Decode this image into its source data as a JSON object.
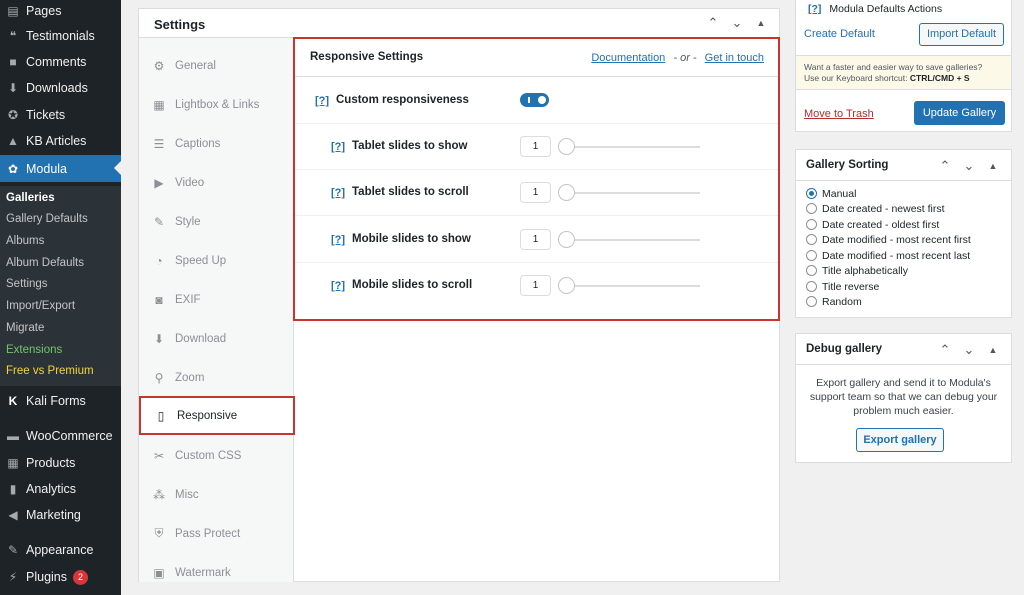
{
  "admin_menu": {
    "items": [
      {
        "label": "Pages",
        "icon": "pages-icon"
      },
      {
        "label": "Testimonials",
        "icon": "quote-icon"
      },
      {
        "label": "Comments",
        "icon": "comment-icon"
      },
      {
        "label": "Downloads",
        "icon": "download-icon"
      },
      {
        "label": "Tickets",
        "icon": "ticket-icon"
      },
      {
        "label": "KB Articles",
        "icon": "graduation-icon"
      },
      {
        "label": "Modula",
        "icon": "gear-icon"
      }
    ],
    "submenu": [
      "Galleries",
      "Gallery Defaults",
      "Albums",
      "Album Defaults",
      "Settings",
      "Import/Export",
      "Migrate",
      "Extensions",
      "Free vs Premium"
    ],
    "items_after": [
      {
        "label": "Kali Forms",
        "icon": "k-icon"
      },
      {
        "label": "WooCommerce",
        "icon": "woo-icon"
      },
      {
        "label": "Products",
        "icon": "archive-icon"
      },
      {
        "label": "Analytics",
        "icon": "chart-icon"
      },
      {
        "label": "Marketing",
        "icon": "megaphone-icon"
      },
      {
        "label": "Appearance",
        "icon": "brush-icon"
      },
      {
        "label": "Plugins",
        "icon": "plugin-icon",
        "badge": "2"
      }
    ]
  },
  "settings": {
    "title": "Settings",
    "tabs": [
      "General",
      "Lightbox & Links",
      "Captions",
      "Video",
      "Style",
      "Speed Up",
      "EXIF",
      "Download",
      "Zoom",
      "Responsive",
      "Custom CSS",
      "Misc",
      "Pass Protect",
      "Watermark"
    ],
    "active_tab": "Responsive"
  },
  "responsive": {
    "title": "Responsive Settings",
    "doc_link": "Documentation",
    "or_text": "- or -",
    "contact_link": "Get in touch",
    "help": "[?]",
    "custom_label": "Custom responsiveness",
    "rows": [
      {
        "label": "Tablet slides to show",
        "value": "1"
      },
      {
        "label": "Tablet slides to scroll",
        "value": "1"
      },
      {
        "label": "Mobile slides to show",
        "value": "1"
      },
      {
        "label": "Mobile slides to scroll",
        "value": "1"
      }
    ]
  },
  "publish_box": {
    "defaults_help": "[?]",
    "defaults_title": "Modula Defaults Actions",
    "create_default": "Create Default",
    "import_default": "Import Default",
    "tip_line1": "Want a faster and easier way to save galleries?",
    "tip_line2": "Use our Keyboard shortcut:",
    "tip_shortcut": "CTRL/CMD + S",
    "move_trash": "Move to Trash",
    "update": "Update Gallery"
  },
  "sorting_box": {
    "title": "Gallery Sorting",
    "options": [
      "Manual",
      "Date created - newest first",
      "Date created - oldest first",
      "Date modified - most recent first",
      "Date modified - most recent last",
      "Title alphabetically",
      "Title reverse",
      "Random"
    ],
    "selected": "Manual"
  },
  "debug_box": {
    "title": "Debug gallery",
    "text": "Export gallery and send it to Modula's support team so that we can debug your problem much easier.",
    "button": "Export gallery"
  },
  "colors": {
    "accent": "#2271b1",
    "highlight_border": "#c9352e",
    "sidebar": "#1d2327"
  }
}
